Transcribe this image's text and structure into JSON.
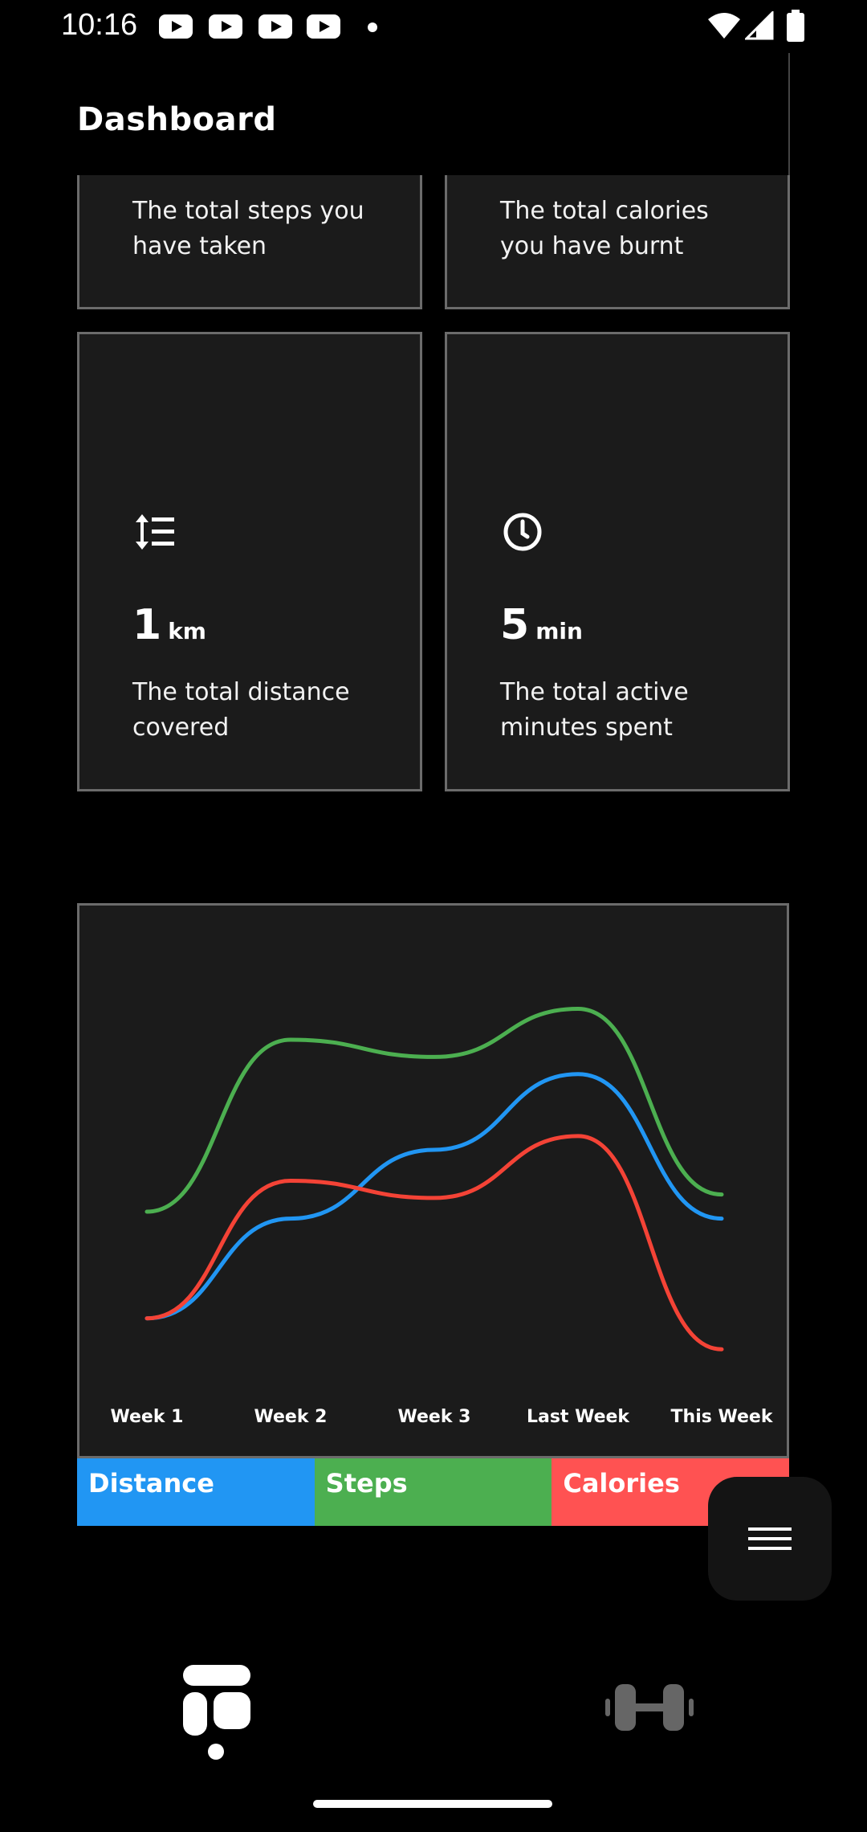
{
  "status_bar": {
    "time": "10:16",
    "icons": [
      "youtube-icon",
      "youtube-icon",
      "youtube-icon",
      "youtube-icon",
      "dot-icon",
      "wifi-icon",
      "signal-icon",
      "battery-icon"
    ]
  },
  "header": {
    "title": "Dashboard"
  },
  "cards": {
    "steps": {
      "description": "The total steps you have taken"
    },
    "calories": {
      "description": "The total calories you have burnt"
    },
    "distance": {
      "value": "1",
      "unit": "km",
      "description": "The total distance covered",
      "icon": "sort-list-icon"
    },
    "active": {
      "value": "5",
      "unit": "min",
      "description": "The total active minutes spent",
      "icon": "clock-icon"
    }
  },
  "chart_data": {
    "type": "line",
    "categories": [
      "Week 1",
      "Week 2",
      "Week 3",
      "Last Week",
      "This Week"
    ],
    "series": [
      {
        "name": "Steps",
        "values": [
          7.1,
          12.1,
          11.6,
          13.0,
          7.6
        ]
      },
      {
        "name": "Distance",
        "values": [
          4.0,
          6.9,
          8.9,
          11.1,
          6.9
        ]
      },
      {
        "name": "Calories",
        "values": [
          4.0,
          8.0,
          7.5,
          9.3,
          3.1
        ]
      }
    ],
    "ylim": [
      0,
      16
    ],
    "grid": false,
    "legend": "bottom",
    "colors": {
      "Steps": "#4caf50",
      "Distance": "#2196f3",
      "Calories": "#f44336"
    }
  },
  "legend": {
    "items": [
      {
        "label": "Distance",
        "color": "#2196f3"
      },
      {
        "label": "Steps",
        "color": "#4caf50"
      },
      {
        "label": "Calories",
        "color": "#ff5252"
      }
    ]
  },
  "fab": {
    "icon": "menu-icon"
  },
  "bottom_nav": {
    "items": [
      {
        "icon": "dashboard-icon",
        "selected": true
      },
      {
        "icon": "dumbbell-icon",
        "selected": false
      }
    ]
  }
}
